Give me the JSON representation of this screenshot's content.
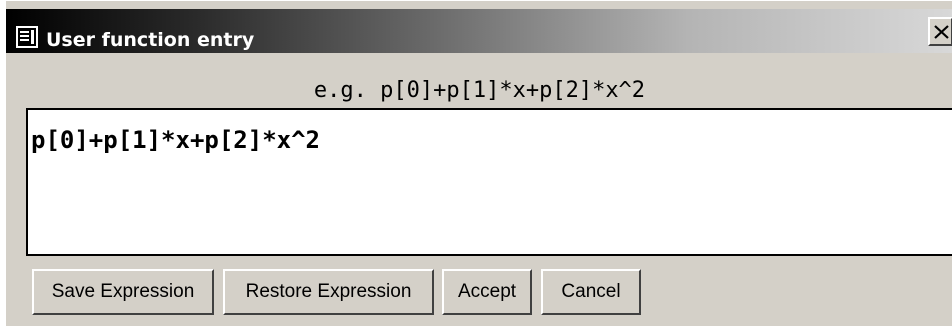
{
  "window": {
    "title": "User function entry",
    "close_glyph": "X",
    "title_icon": "window-app-icon",
    "close_icon": "close-icon"
  },
  "hint": {
    "text": "e.g. p[0]+p[1]*x+p[2]*x^2"
  },
  "expression": {
    "value": "p[0]+p[1]*x+p[2]*x^2"
  },
  "buttons": {
    "save_label": "Save Expression",
    "restore_label": "Restore Expression",
    "accept_label": "Accept",
    "cancel_label": "Cancel"
  },
  "colors": {
    "dialog_background": "#d4d0c8",
    "titlebar_start": "#000000",
    "titlebar_end": "#d8d8d8",
    "title_text": "#ffffff",
    "text_area_background": "#ffffff"
  }
}
